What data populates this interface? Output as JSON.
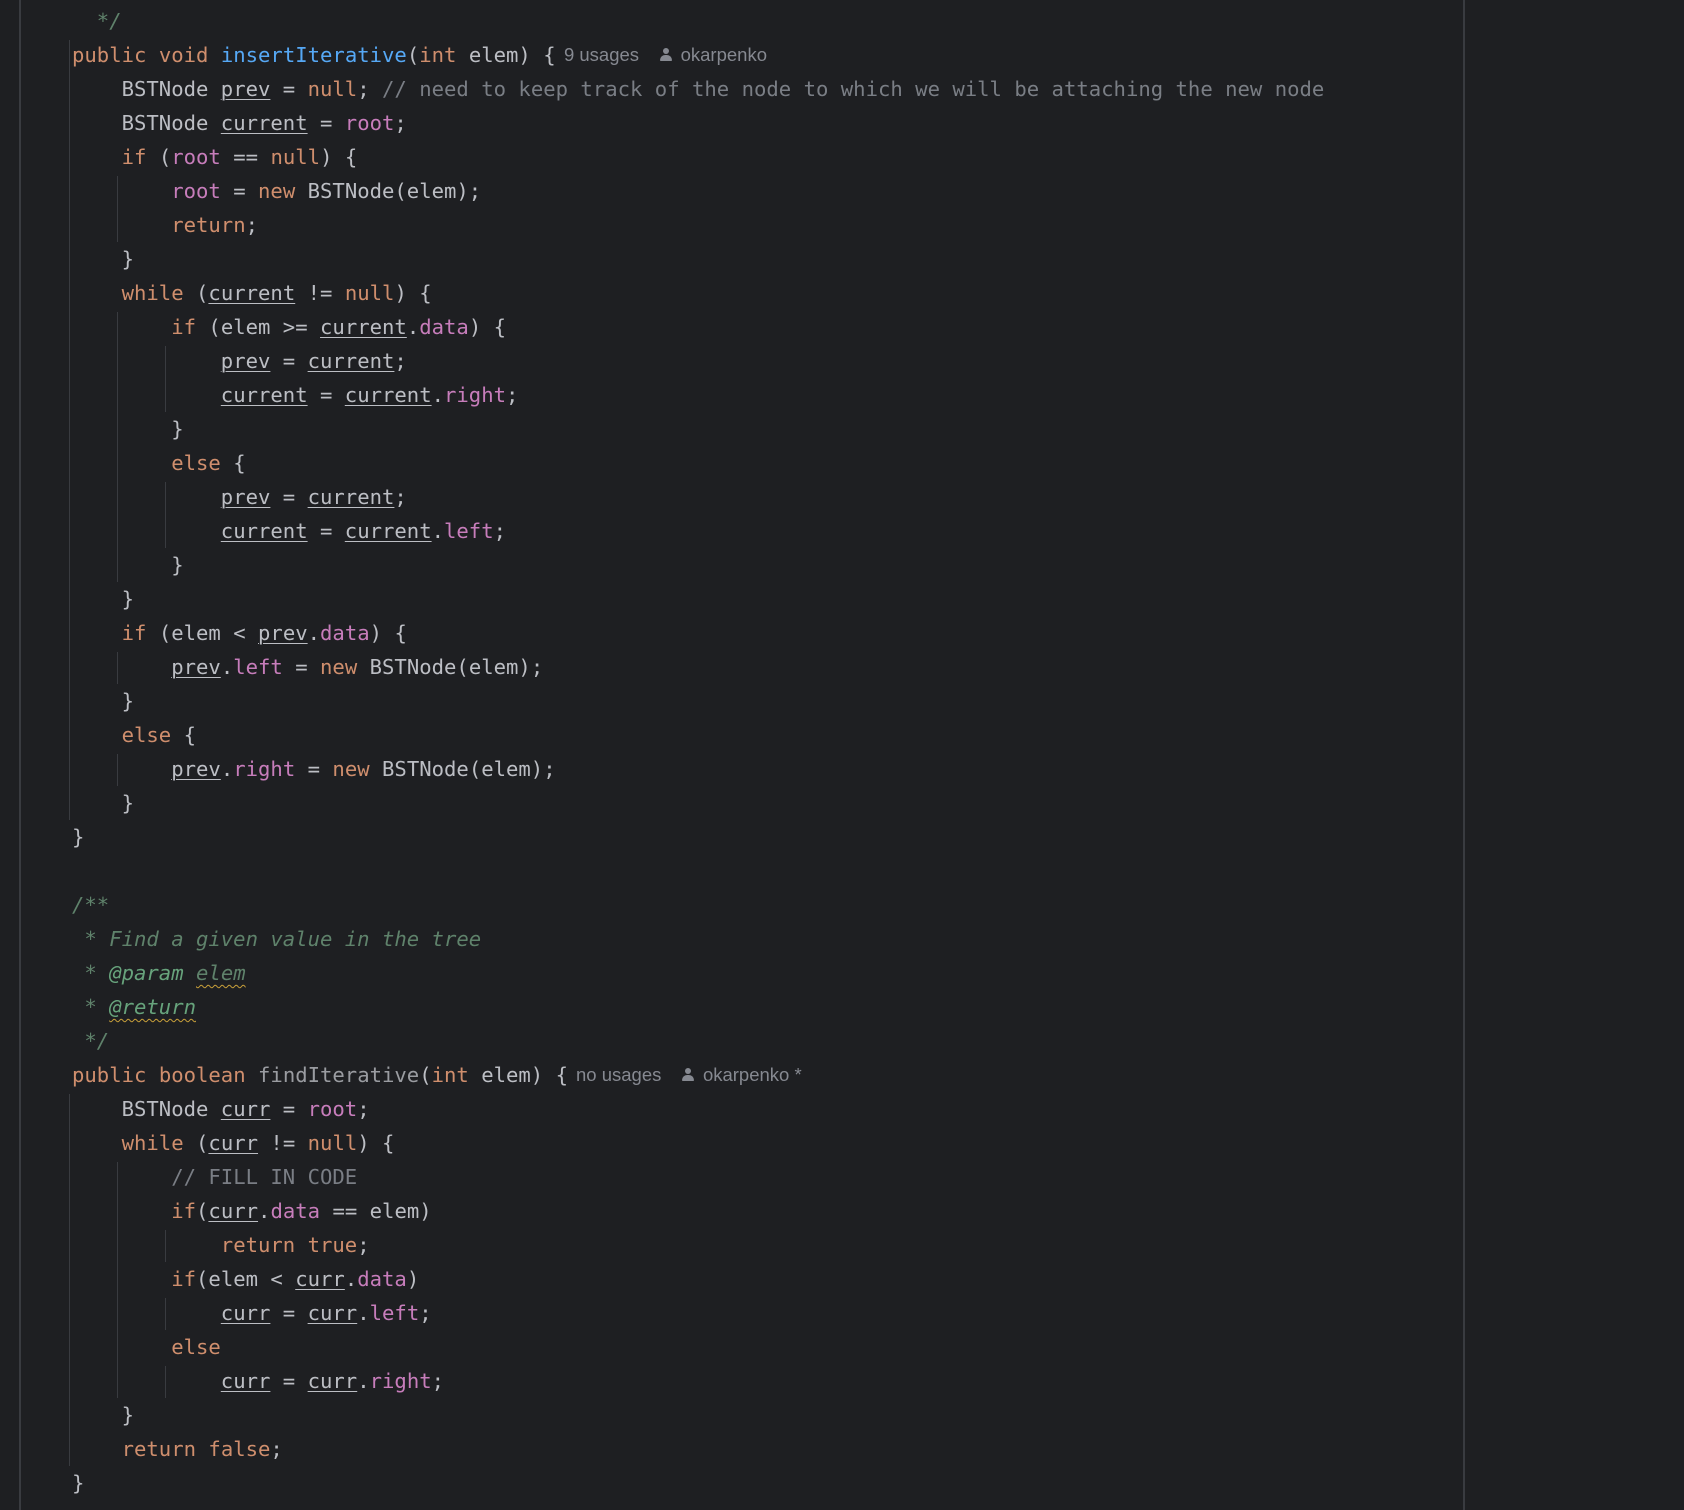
{
  "editor": {
    "language": "java",
    "colors": {
      "background": "#1e1f22",
      "text": "#bcbec4",
      "keyword": "#cf8e6d",
      "function": "#56a8f5",
      "unused_function": "#9a9ca1",
      "field": "#c77dbb",
      "comment": "#7a7e85",
      "doc_comment": "#5f826b",
      "doc_tag": "#67a37c",
      "inlay_hint": "#868991",
      "guide": "#393b40",
      "margin_line": "#393b40",
      "warning_underline": "#c9a03a"
    },
    "lines": [
      {
        "tokens": [
          {
            "t": "  */",
            "c": "doc"
          }
        ]
      },
      {
        "tokens": [
          {
            "t": "public",
            "c": "kw"
          },
          {
            "t": " "
          },
          {
            "t": "void",
            "c": "kw"
          },
          {
            "t": " "
          },
          {
            "t": "insertIterative",
            "c": "fn"
          },
          {
            "t": "("
          },
          {
            "t": "int",
            "c": "kw"
          },
          {
            "t": " elem) {"
          }
        ],
        "hint": {
          "usages": "9 usages",
          "author": "okarpenko",
          "author_icon": "person-icon"
        }
      },
      {
        "tokens": [
          {
            "t": "    BSTNode "
          },
          {
            "t": "prev",
            "c": "var"
          },
          {
            "t": " = "
          },
          {
            "t": "null",
            "c": "kw"
          },
          {
            "t": "; "
          },
          {
            "t": "// need to keep track of the node to which we will be attaching the new node",
            "c": "cmt"
          }
        ]
      },
      {
        "tokens": [
          {
            "t": "    BSTNode "
          },
          {
            "t": "current",
            "c": "var"
          },
          {
            "t": " = "
          },
          {
            "t": "root",
            "c": "field"
          },
          {
            "t": ";"
          }
        ]
      },
      {
        "tokens": [
          {
            "t": "    "
          },
          {
            "t": "if",
            "c": "kw"
          },
          {
            "t": " ("
          },
          {
            "t": "root",
            "c": "field"
          },
          {
            "t": " == "
          },
          {
            "t": "null",
            "c": "kw"
          },
          {
            "t": ") {"
          }
        ]
      },
      {
        "tokens": [
          {
            "t": "        "
          },
          {
            "t": "root",
            "c": "field"
          },
          {
            "t": " = "
          },
          {
            "t": "new",
            "c": "kw"
          },
          {
            "t": " BSTNode(elem);"
          }
        ]
      },
      {
        "tokens": [
          {
            "t": "        "
          },
          {
            "t": "return",
            "c": "kw"
          },
          {
            "t": ";"
          }
        ]
      },
      {
        "tokens": [
          {
            "t": "    }"
          }
        ]
      },
      {
        "tokens": [
          {
            "t": "    "
          },
          {
            "t": "while",
            "c": "kw"
          },
          {
            "t": " ("
          },
          {
            "t": "current",
            "c": "var"
          },
          {
            "t": " != "
          },
          {
            "t": "null",
            "c": "kw"
          },
          {
            "t": ") {"
          }
        ]
      },
      {
        "tokens": [
          {
            "t": "        "
          },
          {
            "t": "if",
            "c": "kw"
          },
          {
            "t": " (elem >= "
          },
          {
            "t": "current",
            "c": "var"
          },
          {
            "t": "."
          },
          {
            "t": "data",
            "c": "field"
          },
          {
            "t": ") {"
          }
        ]
      },
      {
        "tokens": [
          {
            "t": "            "
          },
          {
            "t": "prev",
            "c": "var"
          },
          {
            "t": " = "
          },
          {
            "t": "current",
            "c": "var"
          },
          {
            "t": ";"
          }
        ]
      },
      {
        "tokens": [
          {
            "t": "            "
          },
          {
            "t": "current",
            "c": "var"
          },
          {
            "t": " = "
          },
          {
            "t": "current",
            "c": "var"
          },
          {
            "t": "."
          },
          {
            "t": "right",
            "c": "field"
          },
          {
            "t": ";"
          }
        ]
      },
      {
        "tokens": [
          {
            "t": "        }"
          }
        ]
      },
      {
        "tokens": [
          {
            "t": "        "
          },
          {
            "t": "else",
            "c": "kw"
          },
          {
            "t": " {"
          }
        ]
      },
      {
        "tokens": [
          {
            "t": "            "
          },
          {
            "t": "prev",
            "c": "var"
          },
          {
            "t": " = "
          },
          {
            "t": "current",
            "c": "var"
          },
          {
            "t": ";"
          }
        ]
      },
      {
        "tokens": [
          {
            "t": "            "
          },
          {
            "t": "current",
            "c": "var"
          },
          {
            "t": " = "
          },
          {
            "t": "current",
            "c": "var"
          },
          {
            "t": "."
          },
          {
            "t": "left",
            "c": "field"
          },
          {
            "t": ";"
          }
        ]
      },
      {
        "tokens": [
          {
            "t": "        }"
          }
        ]
      },
      {
        "tokens": [
          {
            "t": "    }"
          }
        ]
      },
      {
        "tokens": [
          {
            "t": "    "
          },
          {
            "t": "if",
            "c": "kw"
          },
          {
            "t": " (elem < "
          },
          {
            "t": "prev",
            "c": "var"
          },
          {
            "t": "."
          },
          {
            "t": "data",
            "c": "field"
          },
          {
            "t": ") {"
          }
        ]
      },
      {
        "tokens": [
          {
            "t": "        "
          },
          {
            "t": "prev",
            "c": "var"
          },
          {
            "t": "."
          },
          {
            "t": "left",
            "c": "field"
          },
          {
            "t": " = "
          },
          {
            "t": "new",
            "c": "kw"
          },
          {
            "t": " BSTNode(elem);"
          }
        ]
      },
      {
        "tokens": [
          {
            "t": "    }"
          }
        ]
      },
      {
        "tokens": [
          {
            "t": "    "
          },
          {
            "t": "else",
            "c": "kw"
          },
          {
            "t": " {"
          }
        ]
      },
      {
        "tokens": [
          {
            "t": "        "
          },
          {
            "t": "prev",
            "c": "var"
          },
          {
            "t": "."
          },
          {
            "t": "right",
            "c": "field"
          },
          {
            "t": " = "
          },
          {
            "t": "new",
            "c": "kw"
          },
          {
            "t": " BSTNode(elem);"
          }
        ]
      },
      {
        "tokens": [
          {
            "t": "    }"
          }
        ]
      },
      {
        "tokens": [
          {
            "t": "}"
          }
        ]
      },
      {
        "tokens": []
      },
      {
        "tokens": [
          {
            "t": "/**",
            "c": "doc"
          }
        ]
      },
      {
        "tokens": [
          {
            "t": " * Find a given value in the tree",
            "c": "doc"
          }
        ]
      },
      {
        "tokens": [
          {
            "t": " * ",
            "c": "doc"
          },
          {
            "t": "@param",
            "c": "doctag"
          },
          {
            "t": " ",
            "c": "doc"
          },
          {
            "t": "elem",
            "c": "doc",
            "warn": true
          }
        ]
      },
      {
        "tokens": [
          {
            "t": " * ",
            "c": "doc"
          },
          {
            "t": "@return",
            "c": "doctag",
            "warn": true
          }
        ]
      },
      {
        "tokens": [
          {
            "t": " */",
            "c": "doc"
          }
        ]
      },
      {
        "tokens": [
          {
            "t": "public",
            "c": "kw"
          },
          {
            "t": " "
          },
          {
            "t": "boolean",
            "c": "kw"
          },
          {
            "t": " "
          },
          {
            "t": "findIterative",
            "c": "fn-unused"
          },
          {
            "t": "("
          },
          {
            "t": "int",
            "c": "kw"
          },
          {
            "t": " elem) {"
          }
        ],
        "hint": {
          "usages": "no usages",
          "author": "okarpenko *",
          "author_icon": "person-icon"
        }
      },
      {
        "tokens": [
          {
            "t": "    BSTNode "
          },
          {
            "t": "curr",
            "c": "var"
          },
          {
            "t": " = "
          },
          {
            "t": "root",
            "c": "field"
          },
          {
            "t": ";"
          }
        ]
      },
      {
        "tokens": [
          {
            "t": "    "
          },
          {
            "t": "while",
            "c": "kw"
          },
          {
            "t": " ("
          },
          {
            "t": "curr",
            "c": "var"
          },
          {
            "t": " != "
          },
          {
            "t": "null",
            "c": "kw"
          },
          {
            "t": ") {"
          }
        ]
      },
      {
        "tokens": [
          {
            "t": "        "
          },
          {
            "t": "// FILL IN CODE",
            "c": "cmt"
          }
        ]
      },
      {
        "tokens": [
          {
            "t": "        "
          },
          {
            "t": "if",
            "c": "kw"
          },
          {
            "t": "("
          },
          {
            "t": "curr",
            "c": "var"
          },
          {
            "t": "."
          },
          {
            "t": "data",
            "c": "field"
          },
          {
            "t": " == elem)"
          }
        ]
      },
      {
        "tokens": [
          {
            "t": "            "
          },
          {
            "t": "return",
            "c": "kw"
          },
          {
            "t": " "
          },
          {
            "t": "true",
            "c": "kw"
          },
          {
            "t": ";"
          }
        ]
      },
      {
        "tokens": [
          {
            "t": "        "
          },
          {
            "t": "if",
            "c": "kw"
          },
          {
            "t": "(elem < "
          },
          {
            "t": "curr",
            "c": "var"
          },
          {
            "t": "."
          },
          {
            "t": "data",
            "c": "field"
          },
          {
            "t": ")"
          }
        ]
      },
      {
        "tokens": [
          {
            "t": "            "
          },
          {
            "t": "curr",
            "c": "var"
          },
          {
            "t": " = "
          },
          {
            "t": "curr",
            "c": "var"
          },
          {
            "t": "."
          },
          {
            "t": "left",
            "c": "field"
          },
          {
            "t": ";"
          }
        ]
      },
      {
        "tokens": [
          {
            "t": "        "
          },
          {
            "t": "else",
            "c": "kw"
          }
        ]
      },
      {
        "tokens": [
          {
            "t": "            "
          },
          {
            "t": "curr",
            "c": "var"
          },
          {
            "t": " = "
          },
          {
            "t": "curr",
            "c": "var"
          },
          {
            "t": "."
          },
          {
            "t": "right",
            "c": "field"
          },
          {
            "t": ";"
          }
        ]
      },
      {
        "tokens": [
          {
            "t": "    }"
          }
        ]
      },
      {
        "tokens": [
          {
            "t": "    "
          },
          {
            "t": "return",
            "c": "kw"
          },
          {
            "t": " "
          },
          {
            "t": "false",
            "c": "kw"
          },
          {
            "t": ";"
          }
        ]
      },
      {
        "tokens": [
          {
            "t": "}"
          }
        ]
      }
    ]
  }
}
